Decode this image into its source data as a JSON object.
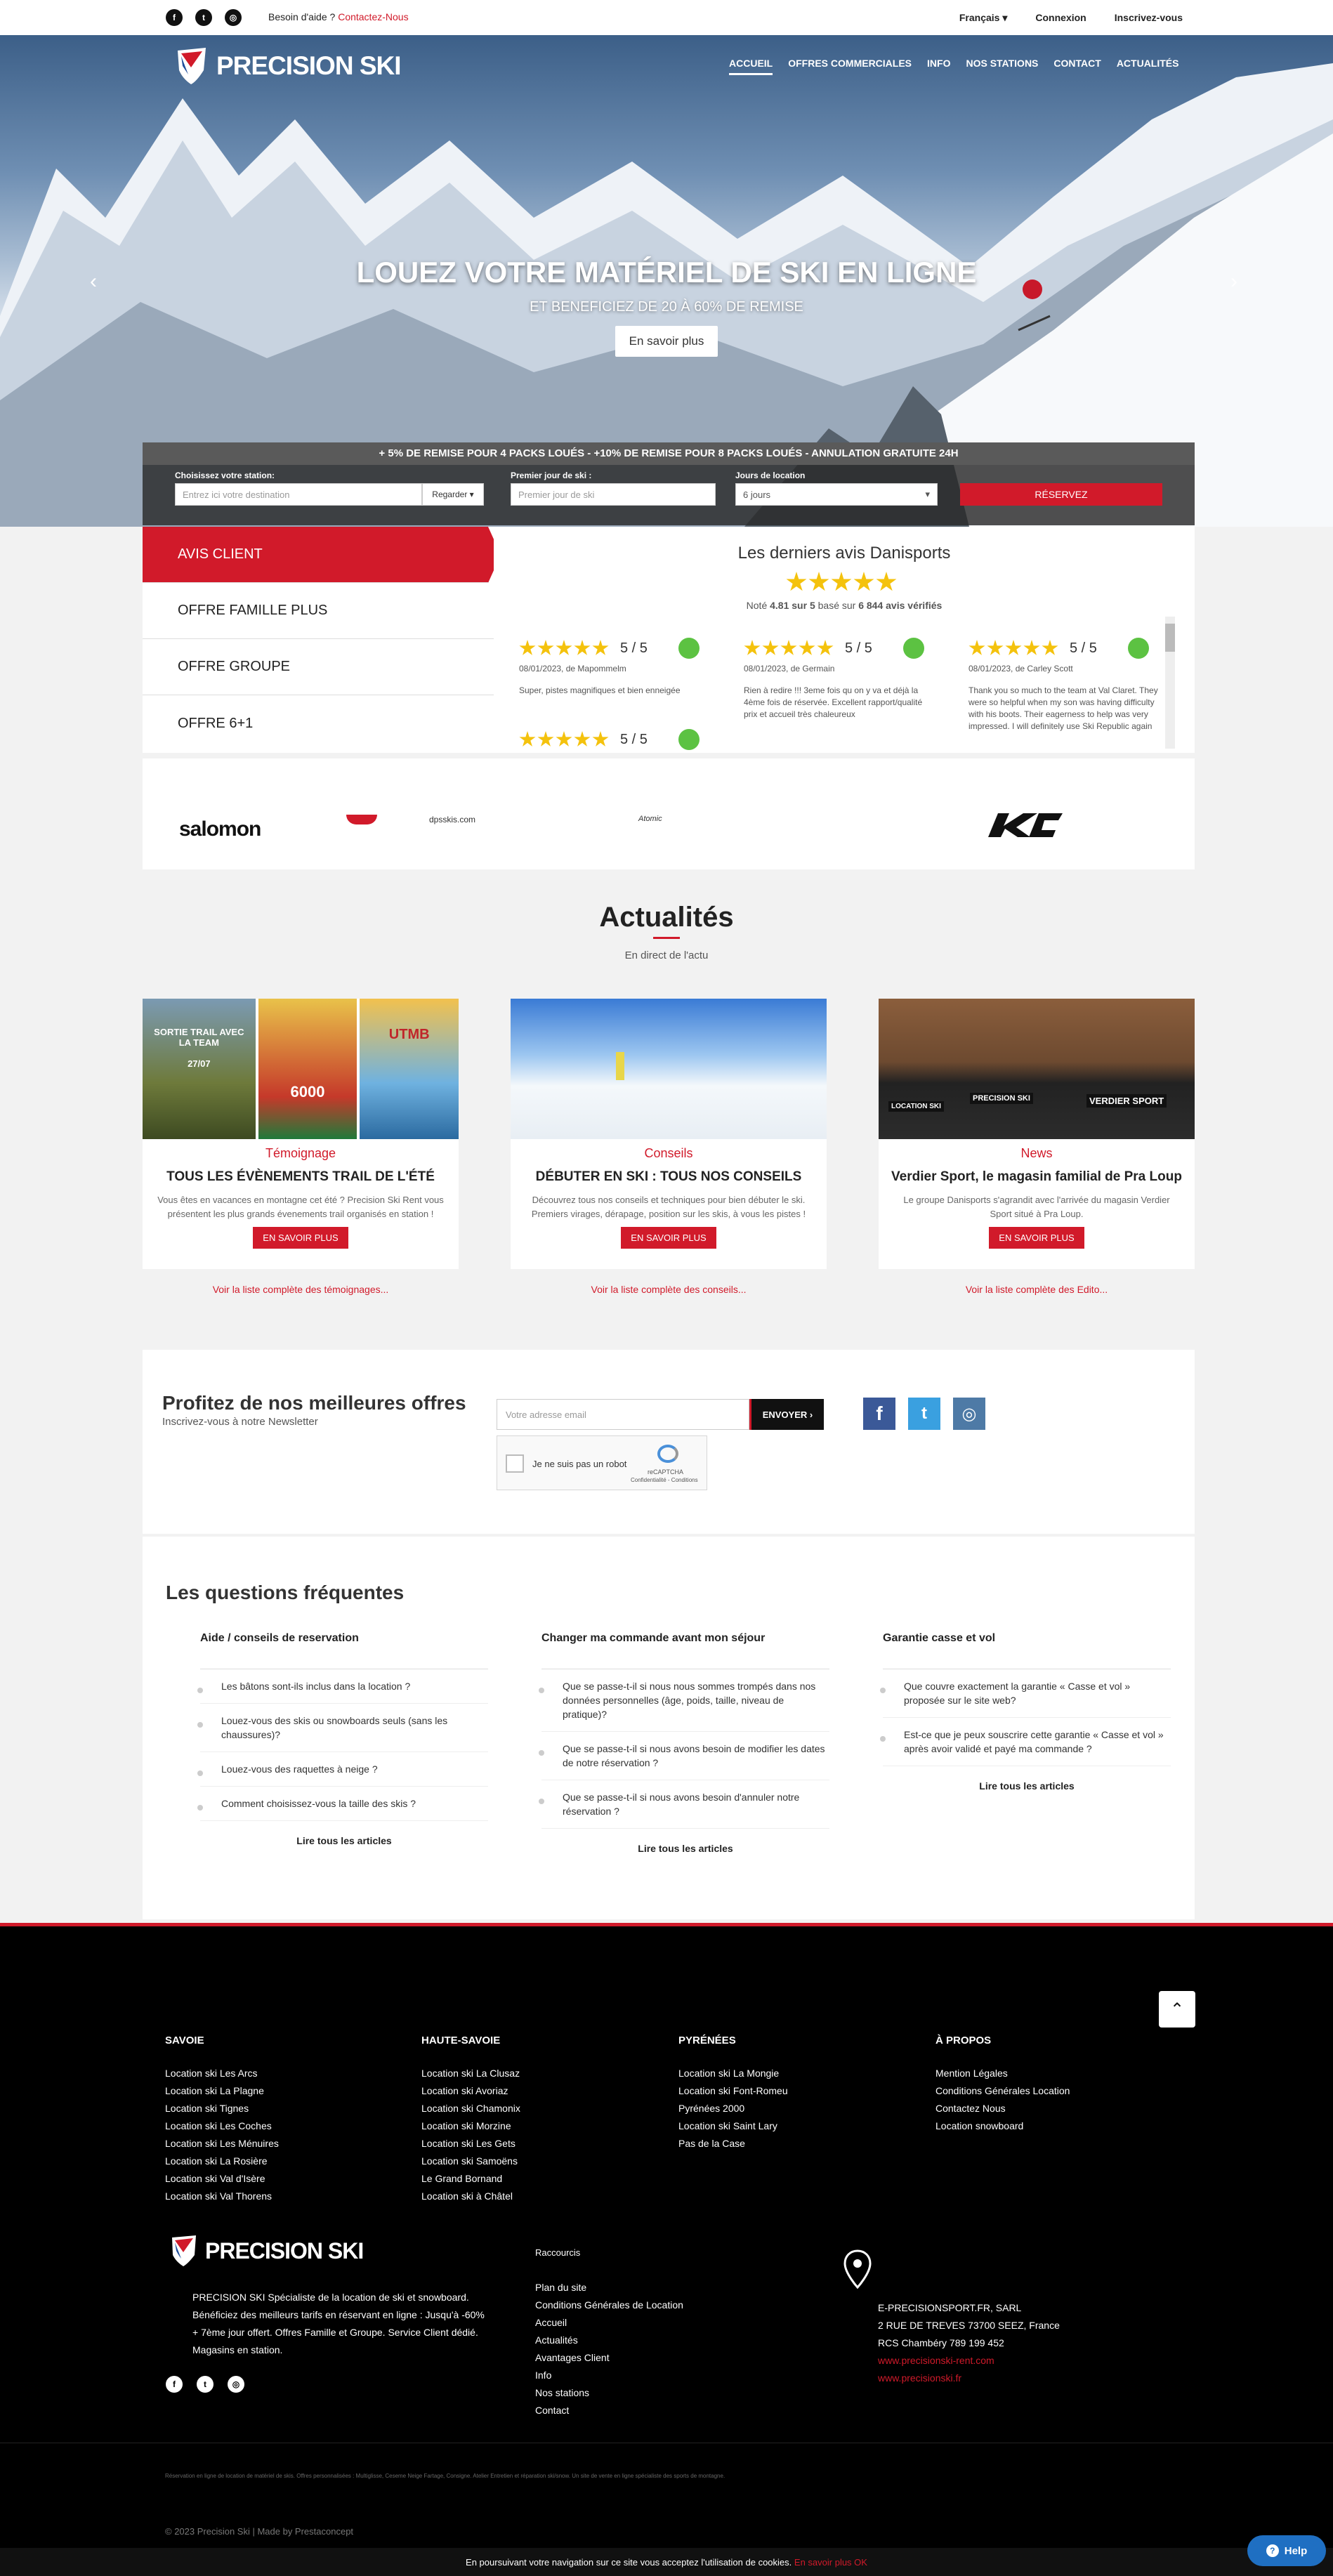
{
  "topbar": {
    "help": "Besoin d'aide ?",
    "help_link": "Contactez-Nous",
    "language": "Français",
    "login": "Connexion",
    "register": "Inscrivez-vous"
  },
  "brand": {
    "name": "PRECISION SKI"
  },
  "nav": [
    "ACCUEIL",
    "OFFRES COMMERCIALES",
    "INFO",
    "NOS STATIONS",
    "CONTACT",
    "ACTUALITÉS"
  ],
  "hero": {
    "title": "LOUEZ VOTRE MATÉRIEL DE SKI EN LIGNE",
    "subtitle": "ET BENEFICIEZ DE 20 À 60% DE REMISE",
    "button": "En savoir plus"
  },
  "booking": {
    "promo": "+ 5% DE REMISE POUR 4 PACKS LOUÉS  -  +10% DE REMISE POUR 8 PACKS LOUÉS - ANNULATION GRATUITE 24H",
    "station_label": "Choisissez votre station:",
    "station_placeholder": "Entrez ici votre destination",
    "browse": "Regarder",
    "date_label": "Premier jour de ski :",
    "date_placeholder": "Premier jour de ski",
    "days_label": "Jours de location",
    "days_value": "6 jours",
    "reserve": "RÉSERVEZ"
  },
  "tabs": [
    "AVIS CLIENT",
    "OFFRE FAMILLE PLUS",
    "OFFRE GROUPE",
    "OFFRE 6+1"
  ],
  "avis": {
    "title": "Les derniers avis Danisports",
    "note_prefix": "Noté",
    "note": "4.81 sur 5",
    "based": "basé sur",
    "count": "6 844 avis vérifiés",
    "reviews": [
      {
        "score": "5 / 5",
        "meta": "08/01/2023, de Mapommelm",
        "text": "Super, pistes magnifiques et bien enneigée"
      },
      {
        "score": "5 / 5",
        "meta": "08/01/2023, de Germain",
        "text": "Rien à redire !!! 3eme fois qu on y va et déjà la 4ème fois de réservée. Excellent rapport/qualité prix et accueil très chaleureux"
      },
      {
        "score": "5 / 5",
        "meta": "08/01/2023, de Carley Scott",
        "text": "Thank you so much to the team at Val Claret. They were so helpful when my son was having difficulty with his boots. Their eagerness to help was very impressed. I will definitely use Ski Republic again"
      },
      {
        "score": "5 / 5",
        "meta": "",
        "text": ""
      }
    ]
  },
  "brands": [
    "salomon",
    "dpsskis.com",
    "Atomic"
  ],
  "news": {
    "title": "Actualités",
    "subtitle": "En direct de l'actu",
    "cards": [
      {
        "category": "Témoignage",
        "title": "TOUS LES ÉVÈNEMENTS TRAIL DE L'ÉTÉ",
        "text": "Vous êtes en vacances en montagne cet été ? Precision Ski Rent vous présentent les plus grands évenements trail organisés en station !",
        "button": "EN SAVOIR PLUS",
        "more": "Voir la liste complète des témoignages...",
        "poster1": "SORTIE TRAIL AVEC LA TEAM",
        "poster1_date": "27/07",
        "poster2": "6000",
        "poster3": "UTMB"
      },
      {
        "category": "Conseils",
        "title": "DÉBUTER EN SKI : TOUS NOS CONSEILS",
        "text": "Découvrez tous nos conseils et techniques pour bien débuter le ski. Premiers virages, dérapage, position sur les skis, à vous les pistes !",
        "button": "EN SAVOIR PLUS",
        "more": "Voir la liste complète des conseils..."
      },
      {
        "category": "News",
        "title": "Verdier Sport, le magasin familial de Pra Loup",
        "text": "Le groupe Danisports s'agrandit avec l'arrivée du magasin Verdier Sport situé à Pra Loup.",
        "button": "EN SAVOIR PLUS",
        "more": "Voir la liste complète des Edito...",
        "shop_sign1": "LOCATION SKI",
        "shop_sign2": "PRECISION SKI",
        "shop_sign3": "VERDIER SPORT"
      }
    ]
  },
  "newsletter": {
    "title": "Profitez de nos meilleures offres",
    "subtitle": "Inscrivez-vous à notre Newsletter",
    "placeholder": "Votre adresse email",
    "button": "ENVOYER",
    "captcha": "Je ne suis pas un robot",
    "captcha_brand": "reCAPTCHA",
    "captcha_terms": "Confidentialité - Conditions"
  },
  "faq": {
    "title": "Les questions fréquentes",
    "more": "Lire tous les articles",
    "columns": [
      {
        "title": "Aide / conseils de reservation",
        "items": [
          "Les bâtons sont-ils inclus dans la location ?",
          "Louez-vous des skis ou snowboards seuls (sans les chaussures)?",
          "Louez-vous des raquettes à neige ?",
          "Comment choisissez-vous la taille des skis ?"
        ]
      },
      {
        "title": "Changer ma commande avant mon séjour",
        "items": [
          "Que se passe-t-il si nous nous sommes trompés dans nos données personnelles (âge, poids, taille, niveau de pratique)?",
          "Que se passe-t-il si nous avons besoin de modifier les dates de notre réservation ?",
          "Que se passe-t-il si nous avons besoin d'annuler notre réservation ?"
        ]
      },
      {
        "title": "Garantie casse et vol",
        "items": [
          "Que couvre exactement la garantie « Casse et vol » proposée sur le site web?",
          "Est-ce que je peux souscrire cette garantie « Casse et vol » après avoir validé et payé ma commande ?"
        ]
      }
    ]
  },
  "footer": {
    "cols": [
      {
        "title": "SAVOIE",
        "links": [
          "Location ski Les Arcs",
          "Location ski La Plagne",
          "Location ski Tignes",
          "Location ski Les Coches",
          "Location ski Les Ménuires",
          "Location ski La Rosière",
          "Location ski Val d'Isère",
          "Location ski Val Thorens"
        ]
      },
      {
        "title": "HAUTE-SAVOIE",
        "links": [
          "Location ski La Clusaz",
          "Location ski Avoriaz",
          "Location ski Chamonix",
          "Location ski Morzine",
          "Location ski Les Gets",
          "Location ski Samoëns",
          "Le Grand Bornand",
          "Location ski à Châtel"
        ]
      },
      {
        "title": "PYRÉNÉES",
        "links": [
          "Location ski La Mongie",
          "Location ski Font-Romeu",
          "Pyrénées 2000",
          "Location ski Saint Lary",
          "Pas de la Case"
        ]
      },
      {
        "title": "À PROPOS",
        "links": [
          "Mention Légales",
          "Conditions Générales Location",
          "Contactez Nous",
          "Location snowboard"
        ]
      }
    ],
    "about": "PRECISION SKI Spécialiste de la location de ski et snowboard. Bénéficiez des meilleurs tarifs en réservant en ligne : Jusqu'à -60% + 7ème jour offert. Offres Famille et Groupe. Service Client dédié. Magasins en station.",
    "shortcuts_title": "Raccourcis",
    "shortcuts": [
      "Plan du site",
      "Conditions Générales de Location",
      "Accueil",
      "Actualités",
      "Avantages Client",
      "Info",
      "Nos stations",
      "Contact"
    ],
    "address": [
      "E-PRECISIONSPORT.FR, SARL",
      "2 RUE DE TREVES 73700 SEEZ, France",
      "RCS Chambéry 789 199 452"
    ],
    "address_links": [
      "www.precisionski-rent.com",
      "www.precisionski.fr"
    ],
    "legal": "Réservation en ligne de location de matériel de skis. Offres personnalisées : Multiglisse, Ceseme Neige Fartage, Consigne. Atelier Entretien et réparation ski/snow. Un site de vente en ligne spécialiste des sports de montagne.",
    "copyright": "© 2023 Precision Ski  |  Made by Prestaconcept",
    "cookie": "En poursuivant votre navigation sur ce site vous acceptez l'utilisation de cookies.",
    "cookie_link": "En savoir plus OK",
    "help": "Help"
  }
}
